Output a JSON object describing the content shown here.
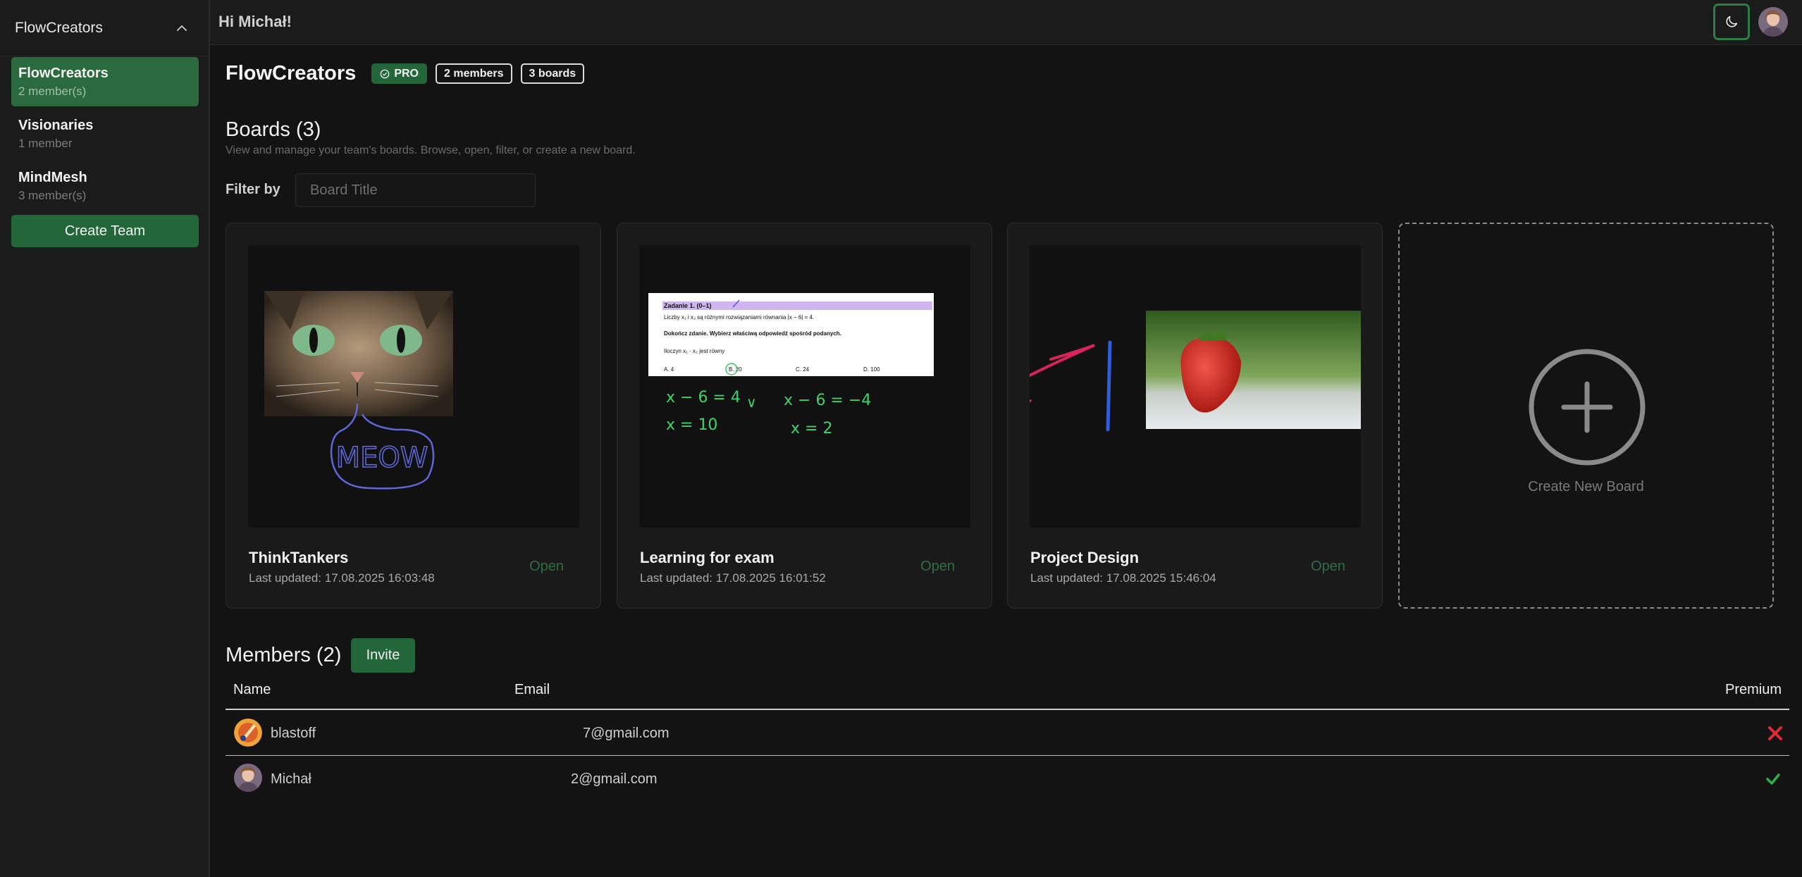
{
  "sidebar": {
    "header": "FlowCreators",
    "teams": [
      {
        "name": "FlowCreators",
        "members": "2 member(s)",
        "active": true
      },
      {
        "name": "Visionaries",
        "members": "1 member",
        "active": false
      },
      {
        "name": "MindMesh",
        "members": "3 member(s)",
        "active": false
      }
    ],
    "create_team": "Create Team"
  },
  "topbar": {
    "greeting": "Hi Michał!",
    "theme_icon": "moon-icon"
  },
  "team": {
    "title": "FlowCreators",
    "badges": {
      "pro": "PRO",
      "members": "2 members",
      "boards": "3 boards"
    }
  },
  "boards": {
    "title": "Boards (3)",
    "subtitle": "View and manage your team's boards. Browse, open, filter, or create a new board.",
    "filter_label": "Filter by",
    "filter_placeholder": "Board Title",
    "items": [
      {
        "name": "ThinkTankers",
        "updated": "Last updated: 17.08.2025 16:03:48",
        "open": "Open"
      },
      {
        "name": "Learning for exam",
        "updated": "Last updated: 17.08.2025 16:01:52",
        "open": "Open"
      },
      {
        "name": "Project Design",
        "updated": "Last updated: 17.08.2025 15:46:04",
        "open": "Open"
      }
    ],
    "create_new": "Create New Board",
    "thumb_texts": {
      "meow": "MEOW",
      "exam_heading": "Zadanie 1. (0–1)",
      "exam_line1": "Liczby x₁ i x₂ są różnymi rozwiązaniami równania |x − 6| = 4.",
      "exam_line2": "Dokończ zdanie. Wybierz właściwą odpowiedź spośród podanych.",
      "exam_line3": "Iloczyn x₁ · x₂ jest równy",
      "exam_options": [
        "A. 4",
        "B. 20",
        "C. 24",
        "D. 100"
      ],
      "hw_left1": "x − 6 = 4",
      "hw_left2": "x = 10",
      "hw_or": "∨",
      "hw_right1": "x − 6 = −4",
      "hw_right2": "x = 2"
    }
  },
  "members": {
    "title": "Members (2)",
    "invite": "Invite",
    "columns": {
      "name": "Name",
      "email": "Email",
      "premium": "Premium"
    },
    "rows": [
      {
        "name": "blastoff",
        "email": "7@gmail.com",
        "premium": false
      },
      {
        "name": "Michał",
        "email": "2@gmail.com",
        "premium": true
      }
    ]
  },
  "colors": {
    "accent": "#23663a",
    "background": "#131313",
    "sidebar": "#1b1b1b",
    "danger": "#e02a35",
    "success": "#2fae4c"
  }
}
